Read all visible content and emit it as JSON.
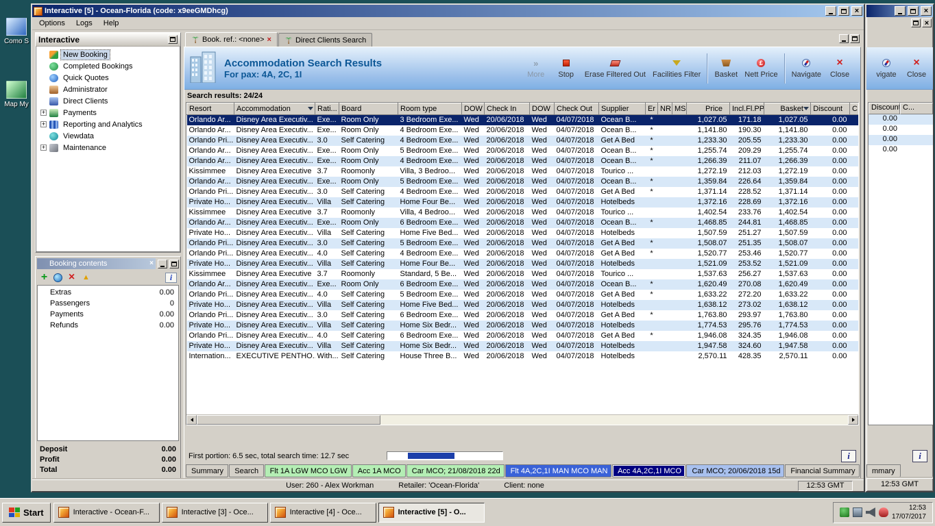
{
  "desktop": {
    "icons": [
      {
        "label": "Como S",
        "icon": "app-icon-blue"
      },
      {
        "label": "Map My",
        "icon": "app-icon-green"
      }
    ]
  },
  "window": {
    "title": "Interactive [5] - Ocean-Florida (code: x9eeGMDhcg)",
    "menu": [
      "Options",
      "Logs",
      "Help"
    ]
  },
  "sidebar": {
    "title": "Interactive",
    "items": [
      {
        "label": "New Booking",
        "icon": "palm-icon",
        "selected": true
      },
      {
        "label": "Completed Bookings",
        "icon": "refresh-icon"
      },
      {
        "label": "Quick Quotes",
        "icon": "globe-icon"
      },
      {
        "label": "Administrator",
        "icon": "admin-icon"
      },
      {
        "label": "Direct Clients",
        "icon": "clients-icon"
      },
      {
        "label": "Payments",
        "icon": "payments-icon",
        "expandable": true
      },
      {
        "label": "Reporting and Analytics",
        "icon": "reporting-icon",
        "expandable": true
      },
      {
        "label": "Viewdata",
        "icon": "viewdata-icon"
      },
      {
        "label": "Maintenance",
        "icon": "maintenance-icon",
        "expandable": true
      }
    ]
  },
  "booking_contents": {
    "title": "Booking contents",
    "toolbar_icons": [
      {
        "icon": "add-icon"
      },
      {
        "icon": "globe2-icon"
      },
      {
        "icon": "delete-icon"
      },
      {
        "icon": "up-icon"
      }
    ],
    "info_label": "i",
    "rows": [
      {
        "label": "Extras",
        "value": "0.00"
      },
      {
        "label": "Passengers",
        "value": "0"
      },
      {
        "label": "Payments",
        "value": "0.00"
      },
      {
        "label": "Refunds",
        "value": "0.00"
      }
    ],
    "totals": [
      {
        "label": "Deposit",
        "value": "0.00"
      },
      {
        "label": "Profit",
        "value": "0.00"
      },
      {
        "label": "Total",
        "value": "0.00"
      }
    ]
  },
  "mdi_tabs": [
    {
      "label": "Book. ref.: <none>",
      "icon": "palm-icon",
      "active": true,
      "closable": true
    },
    {
      "label": "Direct Clients Search",
      "icon": "palm-icon",
      "active": false
    }
  ],
  "results_panel": {
    "title": "Accommodation Search Results",
    "subtitle": "For pax: 4A, 2C, 1I",
    "results_label": "Search results: 24/24",
    "toolbar": [
      {
        "label": "More",
        "icon": "more-icon",
        "disabled": true
      },
      {
        "label": "Stop",
        "icon": "stop-icon"
      },
      {
        "label": "Erase Filtered Out",
        "icon": "eraser-icon"
      },
      {
        "label": "Facilities Filter",
        "icon": "filter-icon",
        "group_end": true
      },
      {
        "label": "Basket",
        "icon": "basket-icon"
      },
      {
        "label": "Nett Price",
        "icon": "price-icon",
        "group_end": true
      },
      {
        "label": "Navigate",
        "icon": "navigate-icon"
      },
      {
        "label": "Close",
        "icon": "closex-icon"
      }
    ]
  },
  "table": {
    "selected_row": 0,
    "columns": [
      {
        "label": "Resort"
      },
      {
        "label": "Accommodation",
        "icon": "funnel-icon"
      },
      {
        "label": "Rati..."
      },
      {
        "label": "Board"
      },
      {
        "label": "Room type"
      },
      {
        "label": "DOW"
      },
      {
        "label": "Check In"
      },
      {
        "label": "DOW"
      },
      {
        "label": "Check Out"
      },
      {
        "label": "Supplier"
      },
      {
        "label": "Er"
      },
      {
        "label": "NR"
      },
      {
        "label": "MS"
      },
      {
        "label": "Price",
        "align": "right"
      },
      {
        "label": "Incl.Fl.PP",
        "align": "right"
      },
      {
        "label": "Basket",
        "align": "right",
        "icon": "funnel-icon"
      },
      {
        "label": "Discount",
        "align": "right"
      },
      {
        "label": "C"
      }
    ],
    "rows": [
      [
        "Orlando Ar...",
        "Disney Area Executiv...",
        "Exe...",
        "Room Only",
        "3 Bedroom Exe...",
        "Wed",
        "20/06/2018",
        "Wed",
        "04/07/2018",
        "Ocean B...",
        "*",
        "",
        "",
        "1,027.05",
        "171.18",
        "1,027.05",
        "0.00",
        ""
      ],
      [
        "Orlando Ar...",
        "Disney Area Executiv...",
        "Exe...",
        "Room Only",
        "4 Bedroom Exe...",
        "Wed",
        "20/06/2018",
        "Wed",
        "04/07/2018",
        "Ocean B...",
        "*",
        "",
        "",
        "1,141.80",
        "190.30",
        "1,141.80",
        "0.00",
        ""
      ],
      [
        "Orlando Pri...",
        "Disney Area Executiv...",
        "3.0",
        "Self Catering",
        "4 Bedroom Exe...",
        "Wed",
        "20/06/2018",
        "Wed",
        "04/07/2018",
        "Get A Bed",
        "*",
        "",
        "",
        "1,233.30",
        "205.55",
        "1,233.30",
        "0.00",
        ""
      ],
      [
        "Orlando Ar...",
        "Disney Area Executiv...",
        "Exe...",
        "Room Only",
        "5 Bedroom Exe...",
        "Wed",
        "20/06/2018",
        "Wed",
        "04/07/2018",
        "Ocean B...",
        "*",
        "",
        "",
        "1,255.74",
        "209.29",
        "1,255.74",
        "0.00",
        ""
      ],
      [
        "Orlando Ar...",
        "Disney Area Executiv...",
        "Exe...",
        "Room Only",
        "4 Bedroom Exe...",
        "Wed",
        "20/06/2018",
        "Wed",
        "04/07/2018",
        "Ocean B...",
        "*",
        "",
        "",
        "1,266.39",
        "211.07",
        "1,266.39",
        "0.00",
        ""
      ],
      [
        "Kissimmee",
        "Disney Area Executive",
        "3.7",
        "Roomonly",
        "Villa, 3 Bedroo...",
        "Wed",
        "20/06/2018",
        "Wed",
        "04/07/2018",
        "Tourico ...",
        "",
        "",
        "",
        "1,272.19",
        "212.03",
        "1,272.19",
        "0.00",
        ""
      ],
      [
        "Orlando Ar...",
        "Disney Area Executiv...",
        "Exe...",
        "Room Only",
        "5 Bedroom Exe...",
        "Wed",
        "20/06/2018",
        "Wed",
        "04/07/2018",
        "Ocean B...",
        "*",
        "",
        "",
        "1,359.84",
        "226.64",
        "1,359.84",
        "0.00",
        ""
      ],
      [
        "Orlando Pri...",
        "Disney Area Executiv...",
        "3.0",
        "Self Catering",
        "4 Bedroom Exe...",
        "Wed",
        "20/06/2018",
        "Wed",
        "04/07/2018",
        "Get A Bed",
        "*",
        "",
        "",
        "1,371.14",
        "228.52",
        "1,371.14",
        "0.00",
        ""
      ],
      [
        "Private Ho...",
        "Disney Area Executiv...",
        "Villa",
        "Self Catering",
        "Home Four Be...",
        "Wed",
        "20/06/2018",
        "Wed",
        "04/07/2018",
        "Hotelbeds",
        "",
        "",
        "",
        "1,372.16",
        "228.69",
        "1,372.16",
        "0.00",
        ""
      ],
      [
        "Kissimmee",
        "Disney Area Executive",
        "3.7",
        "Roomonly",
        "Villa, 4 Bedroo...",
        "Wed",
        "20/06/2018",
        "Wed",
        "04/07/2018",
        "Tourico ...",
        "",
        "",
        "",
        "1,402.54",
        "233.76",
        "1,402.54",
        "0.00",
        ""
      ],
      [
        "Orlando Ar...",
        "Disney Area Executiv...",
        "Exe...",
        "Room Only",
        "6 Bedroom Exe...",
        "Wed",
        "20/06/2018",
        "Wed",
        "04/07/2018",
        "Ocean B...",
        "*",
        "",
        "",
        "1,468.85",
        "244.81",
        "1,468.85",
        "0.00",
        ""
      ],
      [
        "Private Ho...",
        "Disney Area Executiv...",
        "Villa",
        "Self Catering",
        "Home Five Bed...",
        "Wed",
        "20/06/2018",
        "Wed",
        "04/07/2018",
        "Hotelbeds",
        "",
        "",
        "",
        "1,507.59",
        "251.27",
        "1,507.59",
        "0.00",
        ""
      ],
      [
        "Orlando Pri...",
        "Disney Area Executiv...",
        "3.0",
        "Self Catering",
        "5 Bedroom Exe...",
        "Wed",
        "20/06/2018",
        "Wed",
        "04/07/2018",
        "Get A Bed",
        "*",
        "",
        "",
        "1,508.07",
        "251.35",
        "1,508.07",
        "0.00",
        ""
      ],
      [
        "Orlando Pri...",
        "Disney Area Executiv...",
        "4.0",
        "Self Catering",
        "4 Bedroom Exe...",
        "Wed",
        "20/06/2018",
        "Wed",
        "04/07/2018",
        "Get A Bed",
        "*",
        "",
        "",
        "1,520.77",
        "253.46",
        "1,520.77",
        "0.00",
        ""
      ],
      [
        "Private Ho...",
        "Disney Area Executiv...",
        "Villa",
        "Self Catering",
        "Home Four Be...",
        "Wed",
        "20/06/2018",
        "Wed",
        "04/07/2018",
        "Hotelbeds",
        "",
        "",
        "",
        "1,521.09",
        "253.52",
        "1,521.09",
        "0.00",
        ""
      ],
      [
        "Kissimmee",
        "Disney Area Executive",
        "3.7",
        "Roomonly",
        "Standard, 5 Be...",
        "Wed",
        "20/06/2018",
        "Wed",
        "04/07/2018",
        "Tourico ...",
        "",
        "",
        "",
        "1,537.63",
        "256.27",
        "1,537.63",
        "0.00",
        ""
      ],
      [
        "Orlando Ar...",
        "Disney Area Executiv...",
        "Exe...",
        "Room Only",
        "6 Bedroom Exe...",
        "Wed",
        "20/06/2018",
        "Wed",
        "04/07/2018",
        "Ocean B...",
        "*",
        "",
        "",
        "1,620.49",
        "270.08",
        "1,620.49",
        "0.00",
        ""
      ],
      [
        "Orlando Pri...",
        "Disney Area Executiv...",
        "4.0",
        "Self Catering",
        "5 Bedroom Exe...",
        "Wed",
        "20/06/2018",
        "Wed",
        "04/07/2018",
        "Get A Bed",
        "*",
        "",
        "",
        "1,633.22",
        "272.20",
        "1,633.22",
        "0.00",
        ""
      ],
      [
        "Private Ho...",
        "Disney Area Executiv...",
        "Villa",
        "Self Catering",
        "Home Five Bed...",
        "Wed",
        "20/06/2018",
        "Wed",
        "04/07/2018",
        "Hotelbeds",
        "",
        "",
        "",
        "1,638.12",
        "273.02",
        "1,638.12",
        "0.00",
        ""
      ],
      [
        "Orlando Pri...",
        "Disney Area Executiv...",
        "3.0",
        "Self Catering",
        "6 Bedroom Exe...",
        "Wed",
        "20/06/2018",
        "Wed",
        "04/07/2018",
        "Get A Bed",
        "*",
        "",
        "",
        "1,763.80",
        "293.97",
        "1,763.80",
        "0.00",
        ""
      ],
      [
        "Private Ho...",
        "Disney Area Executiv...",
        "Villa",
        "Self Catering",
        "Home Six Bedr...",
        "Wed",
        "20/06/2018",
        "Wed",
        "04/07/2018",
        "Hotelbeds",
        "",
        "",
        "",
        "1,774.53",
        "295.76",
        "1,774.53",
        "0.00",
        ""
      ],
      [
        "Orlando Pri...",
        "Disney Area Executiv...",
        "4.0",
        "Self Catering",
        "6 Bedroom Exe...",
        "Wed",
        "20/06/2018",
        "Wed",
        "04/07/2018",
        "Get A Bed",
        "*",
        "",
        "",
        "1,946.08",
        "324.35",
        "1,946.08",
        "0.00",
        ""
      ],
      [
        "Private Ho...",
        "Disney Area Executiv...",
        "Villa",
        "Self Catering",
        "Home Six Bedr...",
        "Wed",
        "20/06/2018",
        "Wed",
        "04/07/2018",
        "Hotelbeds",
        "",
        "",
        "",
        "1,947.58",
        "324.60",
        "1,947.58",
        "0.00",
        ""
      ],
      [
        "Internation...",
        "EXECUTIVE PENTHO...",
        "With...",
        "Self Catering",
        "House Three B...",
        "Wed",
        "20/06/2018",
        "Wed",
        "04/07/2018",
        "Hotelbeds",
        "",
        "",
        "",
        "2,570.11",
        "428.35",
        "2,570.11",
        "0.00",
        ""
      ]
    ]
  },
  "progress": {
    "text": "First portion: 6.5 sec, total search time: 12.7 sec",
    "percent": 40
  },
  "bottom_tabs": [
    {
      "label": "Summary",
      "type": "plain"
    },
    {
      "label": "Search",
      "type": "plain"
    },
    {
      "label": "Flt 1A LGW MCO LGW",
      "type": "green"
    },
    {
      "label": "Acc 1A MCO",
      "type": "green"
    },
    {
      "label": "Car MCO; 21/08/2018 22d",
      "type": "green"
    },
    {
      "label": "Flt 4A,2C,1I MAN MCO MAN",
      "type": "blue"
    },
    {
      "label": "Acc 4A,2C,1I MCO",
      "type": "navy",
      "selected": true
    },
    {
      "label": "Car MCO; 20/06/2018 15d",
      "type": "lightblue"
    },
    {
      "label": "Financial Summary",
      "type": "plain"
    }
  ],
  "status_bar": {
    "user": "User: 260 - Alex Workman",
    "retailer": "Retailer: 'Ocean-Florida'",
    "client": "Client: none",
    "time": "12:53 GMT"
  },
  "background_window": {
    "toolbar": [
      {
        "label": "vigate",
        "icon": "navigate-icon"
      },
      {
        "label": "Close",
        "icon": "closex-icon"
      }
    ],
    "column_headers": [
      "Discount",
      "C..."
    ],
    "rows": [
      "0.00",
      "0.00",
      "0.00",
      "0.00"
    ],
    "tab_fragment": "mmary",
    "time": "12:53 GMT"
  },
  "taskbar": {
    "start_label": "Start",
    "items": [
      {
        "label": "Interactive - Ocean-F...",
        "active": false
      },
      {
        "label": "Interactive [3] - Oce...",
        "active": false
      },
      {
        "label": "Interactive [4] - Oce...",
        "active": false
      },
      {
        "label": "Interactive [5] - O...",
        "active": true
      }
    ],
    "tray": {
      "icons": [
        "tree-icon",
        "display-icon",
        "volume-icon",
        "shield-icon"
      ],
      "time": "12:53",
      "date": "17/07/2017"
    }
  },
  "colors": {
    "titlebar_left": "#0a246a",
    "titlebar_right": "#a6caf0",
    "selected_row": "#0a246a",
    "row_alt": "#d8e8f8",
    "tab_green": "#b4eeb4",
    "tab_blue": "#3a62d8",
    "tab_navy": "#000080",
    "tab_lightblue": "#a8c0ee",
    "progress_fill": "#1c3faa",
    "desktop": "#1b4f57"
  }
}
